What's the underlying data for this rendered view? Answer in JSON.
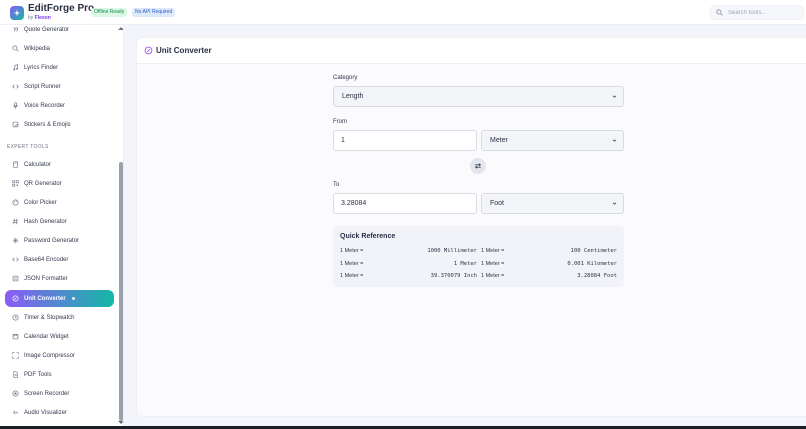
{
  "app": {
    "title": "EditForge Pro",
    "by_prefix": "by",
    "by_name": "Flexon",
    "badges": [
      "Offline Ready",
      "No API Required"
    ],
    "search_placeholder": "Search tools..."
  },
  "sidebar": {
    "top_items": [
      {
        "label": "Quote Generator",
        "icon": "quote-icon"
      },
      {
        "label": "Wikipedia",
        "icon": "search-icon"
      },
      {
        "label": "Lyrics Finder",
        "icon": "music-icon"
      },
      {
        "label": "Script Runner",
        "icon": "code-icon"
      },
      {
        "label": "Voice Recorder",
        "icon": "mic-icon"
      },
      {
        "label": "Stickers & Emojis",
        "icon": "sticker-icon"
      }
    ],
    "section_title": "EXPERT TOOLS",
    "expert_items": [
      {
        "label": "Calculator",
        "icon": "calculator-icon"
      },
      {
        "label": "QR Generator",
        "icon": "qr-icon"
      },
      {
        "label": "Color Picker",
        "icon": "palette-icon"
      },
      {
        "label": "Hash Generator",
        "icon": "hash-icon"
      },
      {
        "label": "Password Generator",
        "icon": "key-icon"
      },
      {
        "label": "Base64 Encoder",
        "icon": "code-icon"
      },
      {
        "label": "JSON Formatter",
        "icon": "braces-icon"
      },
      {
        "label": "Unit Converter",
        "icon": "converter-icon",
        "active": true
      },
      {
        "label": "Timer & Stopwatch",
        "icon": "clock-icon"
      },
      {
        "label": "Calendar Widget",
        "icon": "calendar-icon"
      },
      {
        "label": "Image Compressor",
        "icon": "compress-icon"
      },
      {
        "label": "PDF Tools",
        "icon": "file-icon"
      },
      {
        "label": "Screen Recorder",
        "icon": "record-icon"
      },
      {
        "label": "Audio Visualizer",
        "icon": "audio-icon"
      }
    ]
  },
  "converter": {
    "title": "Unit Converter",
    "category_label": "Category",
    "category_value": "Length",
    "from_label": "From",
    "from_value": "1",
    "from_unit": "Meter",
    "to_label": "To",
    "to_value": "3.28084",
    "to_unit": "Foot",
    "quick_reference": {
      "title": "Quick Reference",
      "rows": [
        {
          "left": "1 Meter =",
          "right": "1000 Millimeter"
        },
        {
          "left": "1 Meter =",
          "right": "100 Centimeter"
        },
        {
          "left": "1 Meter =",
          "right": "1 Meter"
        },
        {
          "left": "1 Meter =",
          "right": "0.001 Kilometer"
        },
        {
          "left": "1 Meter =",
          "right": "39.370079 Inch"
        },
        {
          "left": "1 Meter =",
          "right": "3.28084 Foot"
        }
      ]
    }
  },
  "colors": {
    "accent_start": "#8b5cf6",
    "accent_end": "#14b8a6",
    "badge_green_bg": "#dcf7e6",
    "badge_blue_bg": "#dde8fb"
  }
}
